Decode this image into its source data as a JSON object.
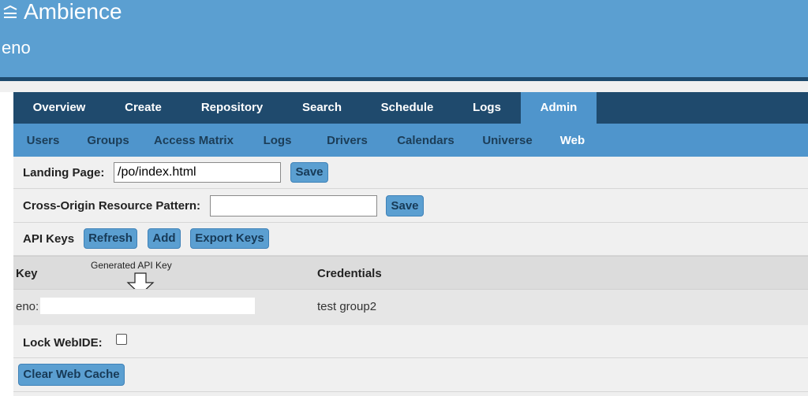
{
  "app": {
    "title": "Ambience",
    "user": "eno"
  },
  "main_nav": {
    "tabs": [
      {
        "label": "Overview"
      },
      {
        "label": "Create"
      },
      {
        "label": "Repository"
      },
      {
        "label": "Search"
      },
      {
        "label": "Schedule"
      },
      {
        "label": "Logs"
      },
      {
        "label": "Admin",
        "active": true
      }
    ]
  },
  "sub_nav": {
    "tabs": [
      {
        "label": "Users"
      },
      {
        "label": "Groups"
      },
      {
        "label": "Access Matrix"
      },
      {
        "label": "Logs"
      },
      {
        "label": "Drivers"
      },
      {
        "label": "Calendars"
      },
      {
        "label": "Universe"
      },
      {
        "label": "Web",
        "active": true
      }
    ]
  },
  "landing_page": {
    "label": "Landing Page:",
    "value": "/po/index.html",
    "save_label": "Save"
  },
  "cors": {
    "label": "Cross-Origin Resource Pattern:",
    "value": "",
    "save_label": "Save"
  },
  "api_keys": {
    "label": "API Keys",
    "refresh_label": "Refresh",
    "add_label": "Add",
    "export_label": "Export Keys",
    "columns": {
      "key": "Key",
      "credentials": "Credentials"
    },
    "annotation": "Generated API Key",
    "rows": [
      {
        "key_prefix": "eno:",
        "credentials": "test group2"
      }
    ]
  },
  "lock_webide": {
    "label": "Lock WebIDE:",
    "checked": false
  },
  "clear_cache": {
    "label": "Clear Web Cache"
  },
  "colors": {
    "header_bg": "#5b9fd1",
    "nav_dark": "#1f4a6d",
    "nav_light": "#4f95cc"
  }
}
